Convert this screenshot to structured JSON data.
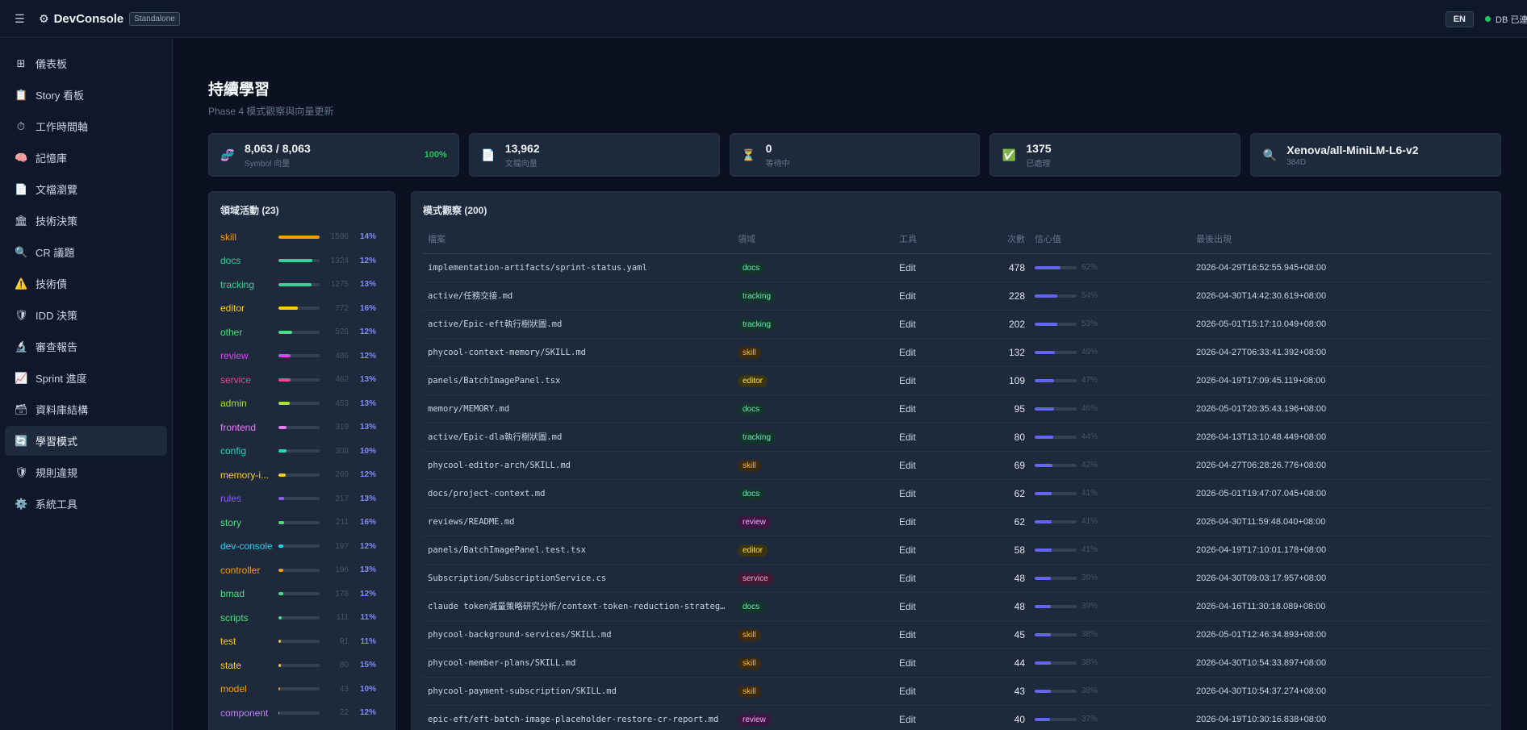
{
  "topbar": {
    "app_name": "DevConsole",
    "mode_badge": "Standalone",
    "lang": "EN",
    "db_status": "DB 已連線"
  },
  "sidebar": {
    "items": [
      {
        "icon": "⊞",
        "icon_name": "dashboard-grid-icon",
        "label": "儀表板"
      },
      {
        "icon": "📋",
        "icon_name": "clipboard-icon",
        "label": "Story 看板"
      },
      {
        "icon": "⏱",
        "icon_name": "stopwatch-icon",
        "label": "工作時間軸"
      },
      {
        "icon": "🧠",
        "icon_name": "brain-icon",
        "label": "記憶庫"
      },
      {
        "icon": "📄",
        "icon_name": "document-icon",
        "label": "文檔瀏覽"
      },
      {
        "icon": "🏛",
        "icon_name": "building-icon",
        "label": "技術決策"
      },
      {
        "icon": "🔍",
        "icon_name": "magnifier-icon",
        "label": "CR 議題"
      },
      {
        "icon": "⚠️",
        "icon_name": "warning-icon",
        "label": "技術債"
      },
      {
        "icon": "🛡",
        "icon_name": "shield-icon",
        "label": "IDD 決策"
      },
      {
        "icon": "🔬",
        "icon_name": "microscope-icon",
        "label": "審查報告"
      },
      {
        "icon": "📈",
        "icon_name": "chart-up-icon",
        "label": "Sprint 進度"
      },
      {
        "icon": "🗃",
        "icon_name": "card-box-icon",
        "label": "資料庫結構"
      },
      {
        "icon": "🔄",
        "icon_name": "refresh-icon",
        "label": "學習模式"
      },
      {
        "icon": "🛡",
        "icon_name": "shield-icon",
        "label": "規則違規"
      },
      {
        "icon": "⚙️",
        "icon_name": "gear-icon",
        "label": "系統工具"
      }
    ],
    "active_index": 12
  },
  "page": {
    "title": "持續學習",
    "subtitle": "Phase 4 模式觀察與向量更新"
  },
  "stats": [
    {
      "icon": "🧬",
      "icon_name": "dna-icon",
      "value": "8,063 / 8,063",
      "label": "Symbol 向量",
      "pct": "100%"
    },
    {
      "icon": "📄",
      "icon_name": "document-icon",
      "value": "13,962",
      "label": "文檔向量",
      "pct": ""
    },
    {
      "icon": "⏳",
      "icon_name": "hourglass-icon",
      "value": "0",
      "label": "等待中",
      "pct": ""
    },
    {
      "icon": "✅",
      "icon_name": "check-box-icon",
      "value": "1375",
      "label": "已處理",
      "pct": ""
    },
    {
      "icon": "🔍",
      "icon_name": "magnifier-icon",
      "value": "Xenova/all-MiniLM-L6-v2",
      "label": "384D",
      "pct": ""
    }
  ],
  "domains": {
    "title": "領域活動 (23)",
    "items": [
      {
        "name": "skill",
        "count": "1596",
        "pct": "14%",
        "fill": 1.0,
        "color": "#f59e0b"
      },
      {
        "name": "docs",
        "count": "1324",
        "pct": "12%",
        "fill": 0.83,
        "color": "#34d399"
      },
      {
        "name": "tracking",
        "count": "1275",
        "pct": "13%",
        "fill": 0.8,
        "color": "#34d399"
      },
      {
        "name": "editor",
        "count": "772",
        "pct": "16%",
        "fill": 0.48,
        "color": "#facc15"
      },
      {
        "name": "other",
        "count": "526",
        "pct": "12%",
        "fill": 0.33,
        "color": "#4ade80"
      },
      {
        "name": "review",
        "count": "486",
        "pct": "12%",
        "fill": 0.3,
        "color": "#d946ef"
      },
      {
        "name": "service",
        "count": "462",
        "pct": "13%",
        "fill": 0.29,
        "color": "#ec4899"
      },
      {
        "name": "admin",
        "count": "453",
        "pct": "13%",
        "fill": 0.28,
        "color": "#a3e635"
      },
      {
        "name": "frontend",
        "count": "319",
        "pct": "13%",
        "fill": 0.2,
        "color": "#e879f9"
      },
      {
        "name": "config",
        "count": "308",
        "pct": "10%",
        "fill": 0.19,
        "color": "#2dd4bf"
      },
      {
        "name": "memory-i...",
        "count": "269",
        "pct": "12%",
        "fill": 0.17,
        "color": "#facc15"
      },
      {
        "name": "rules",
        "count": "217",
        "pct": "13%",
        "fill": 0.14,
        "color": "#8b5cf6"
      },
      {
        "name": "story",
        "count": "211",
        "pct": "16%",
        "fill": 0.13,
        "color": "#4ade80"
      },
      {
        "name": "dev-console",
        "count": "197",
        "pct": "12%",
        "fill": 0.12,
        "color": "#22d3ee"
      },
      {
        "name": "controller",
        "count": "196",
        "pct": "13%",
        "fill": 0.12,
        "color": "#f59e0b"
      },
      {
        "name": "bmad",
        "count": "178",
        "pct": "12%",
        "fill": 0.11,
        "color": "#4ade80"
      },
      {
        "name": "scripts",
        "count": "111",
        "pct": "11%",
        "fill": 0.07,
        "color": "#4ade80"
      },
      {
        "name": "test",
        "count": "91",
        "pct": "11%",
        "fill": 0.06,
        "color": "#facc15"
      },
      {
        "name": "state",
        "count": "80",
        "pct": "15%",
        "fill": 0.05,
        "color": "#facc15"
      },
      {
        "name": "model",
        "count": "43",
        "pct": "10%",
        "fill": 0.03,
        "color": "#f59e0b"
      },
      {
        "name": "component",
        "count": "22",
        "pct": "12%",
        "fill": 0.015,
        "color": "#c084fc"
      }
    ]
  },
  "patterns": {
    "title": "模式觀察 (200)",
    "columns": [
      "檔案",
      "領域",
      "工具",
      "次數",
      "信心值",
      "最後出現"
    ],
    "rows": [
      {
        "file": "implementation-artifacts/sprint-status.yaml",
        "domain": "docs",
        "tool": "Edit",
        "count": "478",
        "conf": "62%",
        "conf_value": 0.62,
        "last": "2026-04-29T16:52:55.945+08:00"
      },
      {
        "file": "active/任務交接.md",
        "domain": "tracking",
        "tool": "Edit",
        "count": "228",
        "conf": "54%",
        "conf_value": 0.54,
        "last": "2026-04-30T14:42:30.619+08:00"
      },
      {
        "file": "active/Epic-eft執行樹狀圖.md",
        "domain": "tracking",
        "tool": "Edit",
        "count": "202",
        "conf": "53%",
        "conf_value": 0.53,
        "last": "2026-05-01T15:17:10.049+08:00"
      },
      {
        "file": "phycool-context-memory/SKILL.md",
        "domain": "skill",
        "tool": "Edit",
        "count": "132",
        "conf": "49%",
        "conf_value": 0.49,
        "last": "2026-04-27T06:33:41.392+08:00"
      },
      {
        "file": "panels/BatchImagePanel.tsx",
        "domain": "editor",
        "tool": "Edit",
        "count": "109",
        "conf": "47%",
        "conf_value": 0.47,
        "last": "2026-04-19T17:09:45.119+08:00"
      },
      {
        "file": "memory/MEMORY.md",
        "domain": "docs",
        "tool": "Edit",
        "count": "95",
        "conf": "46%",
        "conf_value": 0.46,
        "last": "2026-05-01T20:35:43.196+08:00"
      },
      {
        "file": "active/Epic-dla執行樹狀圖.md",
        "domain": "tracking",
        "tool": "Edit",
        "count": "80",
        "conf": "44%",
        "conf_value": 0.44,
        "last": "2026-04-13T13:10:48.449+08:00"
      },
      {
        "file": "phycool-editor-arch/SKILL.md",
        "domain": "skill",
        "tool": "Edit",
        "count": "69",
        "conf": "42%",
        "conf_value": 0.42,
        "last": "2026-04-27T06:28:26.776+08:00"
      },
      {
        "file": "docs/project-context.md",
        "domain": "docs",
        "tool": "Edit",
        "count": "62",
        "conf": "41%",
        "conf_value": 0.41,
        "last": "2026-05-01T19:47:07.045+08:00"
      },
      {
        "file": "reviews/README.md",
        "domain": "review",
        "tool": "Edit",
        "count": "62",
        "conf": "41%",
        "conf_value": 0.41,
        "last": "2026-04-30T11:59:48.040+08:00"
      },
      {
        "file": "panels/BatchImagePanel.test.tsx",
        "domain": "editor",
        "tool": "Edit",
        "count": "58",
        "conf": "41%",
        "conf_value": 0.41,
        "last": "2026-04-19T17:10:01.178+08:00"
      },
      {
        "file": "Subscription/SubscriptionService.cs",
        "domain": "service",
        "tool": "Edit",
        "count": "48",
        "conf": "39%",
        "conf_value": 0.39,
        "last": "2026-04-30T09:03:17.957+08:00"
      },
      {
        "file": "claude token減量策略研究分析/context-token-reduction-strategy.md",
        "domain": "docs",
        "tool": "Edit",
        "count": "48",
        "conf": "39%",
        "conf_value": 0.39,
        "last": "2026-04-16T11:30:18.089+08:00"
      },
      {
        "file": "phycool-background-services/SKILL.md",
        "domain": "skill",
        "tool": "Edit",
        "count": "45",
        "conf": "38%",
        "conf_value": 0.38,
        "last": "2026-05-01T12:46:34.893+08:00"
      },
      {
        "file": "phycool-member-plans/SKILL.md",
        "domain": "skill",
        "tool": "Edit",
        "count": "44",
        "conf": "38%",
        "conf_value": 0.38,
        "last": "2026-04-30T10:54:33.897+08:00"
      },
      {
        "file": "phycool-payment-subscription/SKILL.md",
        "domain": "skill",
        "tool": "Edit",
        "count": "43",
        "conf": "38%",
        "conf_value": 0.38,
        "last": "2026-04-30T10:54:37.274+08:00"
      },
      {
        "file": "epic-eft/eft-batch-image-placeholder-restore-cr-report.md",
        "domain": "review",
        "tool": "Edit",
        "count": "40",
        "conf": "37%",
        "conf_value": 0.37,
        "last": "2026-04-19T10:30:16.838+08:00"
      }
    ]
  },
  "tag_colors": {
    "docs": {
      "bg": "#14352b",
      "fg": "#6ee7b7"
    },
    "tracking": {
      "bg": "#14352b",
      "fg": "#6ee7b7"
    },
    "skill": {
      "bg": "#3b2a12",
      "fg": "#fbbf24"
    },
    "editor": {
      "bg": "#3a3510",
      "fg": "#fde047"
    },
    "review": {
      "bg": "#3b1740",
      "fg": "#f0abfc"
    },
    "service": {
      "bg": "#421733",
      "fg": "#f9a8d4"
    }
  }
}
